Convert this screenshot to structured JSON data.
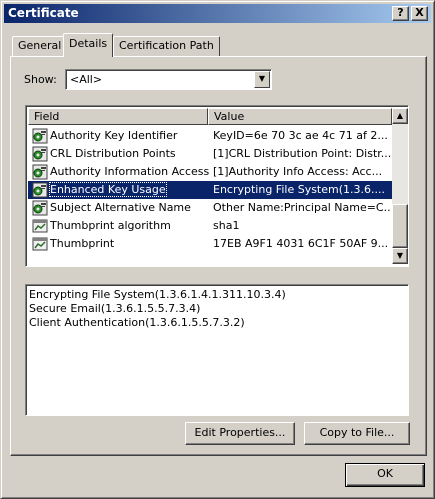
{
  "window": {
    "title": "Certificate",
    "help_glyph": "?",
    "close_glyph": "X"
  },
  "tabs": [
    {
      "label": "General",
      "active": false
    },
    {
      "label": "Details",
      "active": true
    },
    {
      "label": "Certification Path",
      "active": false
    }
  ],
  "show": {
    "label": "Show:",
    "value": "<All>"
  },
  "list": {
    "columns": {
      "field": "Field",
      "value": "Value"
    },
    "rows": [
      {
        "field": "Authority Key Identifier",
        "value": "KeyID=6e 70 3c ae 4c 71 af 2...",
        "icon": "cert-extension-icon",
        "selected": false
      },
      {
        "field": "CRL Distribution Points",
        "value": "[1]CRL Distribution Point: Distr...",
        "icon": "cert-extension-icon",
        "selected": false
      },
      {
        "field": "Authority Information Access",
        "value": "[1]Authority Info Access: Acc...",
        "icon": "cert-extension-icon",
        "selected": false
      },
      {
        "field": "Enhanced Key Usage",
        "value": "Encrypting File System(1.3.6....",
        "icon": "cert-extension-icon",
        "selected": true
      },
      {
        "field": "Subject Alternative Name",
        "value": "Other Name:Principal Name=C...",
        "icon": "cert-extension-icon",
        "selected": false
      },
      {
        "field": "Thumbprint algorithm",
        "value": "sha1",
        "icon": "cert-property-icon",
        "selected": false
      },
      {
        "field": "Thumbprint",
        "value": "17EB A9F1 4031 6C1F 50AF 9...",
        "icon": "cert-property-icon",
        "selected": false
      }
    ]
  },
  "details": {
    "lines": [
      "Encrypting File System(1.3.6.1.4.1.311.10.3.4)",
      "Secure Email(1.3.6.1.5.5.7.3.4)",
      "Client Authentication(1.3.6.1.5.5.7.3.2)"
    ]
  },
  "buttons": {
    "edit_properties": "Edit Properties...",
    "copy_to_file": "Copy to File...",
    "ok": "OK"
  },
  "colors": {
    "selection": "#0a246a",
    "face": "#d4d0c8"
  }
}
